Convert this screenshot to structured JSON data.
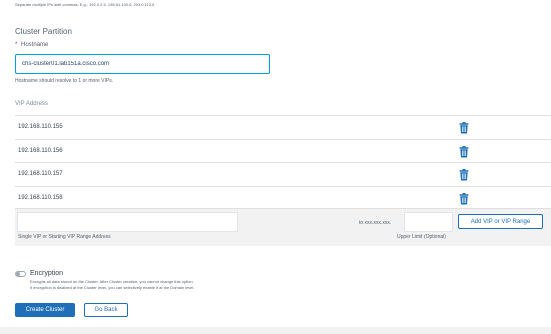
{
  "top_hint": "Separate multiple IPs with commas. E.g., 192.0.2.5, 198.51.100.0, 203.0.113.5",
  "section": {
    "title": "Cluster Partition"
  },
  "hostname": {
    "required_mark": "*",
    "label": "Hostname",
    "value": "chs-cluster01.lab151a.cisco.com",
    "hint": "Hostname should resolve to 1 or more VIPs."
  },
  "vip": {
    "header": "VIP Address",
    "rows": [
      {
        "ip": "192.168.110.155"
      },
      {
        "ip": "192.168.110.156"
      },
      {
        "ip": "192.168.110.157"
      },
      {
        "ip": "192.168.110.158"
      }
    ],
    "delete_icon": "trash-icon"
  },
  "add_panel": {
    "single_value": "",
    "single_label": "Single VIP or Starting VIP Range Address",
    "to_label": "to xxx.xxx.xxx.",
    "upper_value": "",
    "upper_label": "Upper Limit (Optional)",
    "add_button": "Add VIP or VIP Range"
  },
  "encryption": {
    "enabled": false,
    "title": "Encryption",
    "desc_line1": "Encrypts all data stored on the Cluster. After Cluster creation, you cannot change this option.",
    "desc_line2": "If encryption is disabled at the Cluster level, you can selectively enable it at the Domain level."
  },
  "actions": {
    "create": "Create Cluster",
    "back": "Go Back"
  },
  "colors": {
    "primary": "#1e6fb8",
    "focus": "#049fd9",
    "panel": "#f2f2f2",
    "text": "#39424e"
  }
}
